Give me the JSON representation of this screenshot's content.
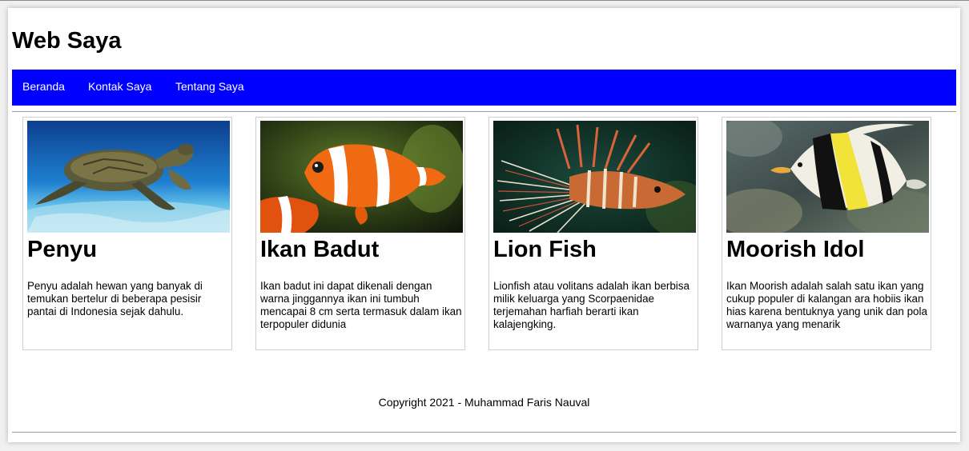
{
  "site": {
    "title": "Web Saya"
  },
  "nav": {
    "items": [
      {
        "label": "Beranda"
      },
      {
        "label": "Kontak Saya"
      },
      {
        "label": "Tentang Saya"
      }
    ],
    "background_color": "#0000ff",
    "text_color": "#ffffff"
  },
  "cards": [
    {
      "title": "Penyu",
      "text": "Penyu adalah hewan yang banyak di temukan bertelur di beberapa pesisir pantai di Indonesia sejak dahulu."
    },
    {
      "title": "Ikan Badut",
      "text": "Ikan badut ini dapat dikenali dengan warna jinggannya ikan ini tumbuh mencapai 8 cm serta termasuk dalam ikan terpopuler didunia"
    },
    {
      "title": "Lion Fish",
      "text": "Lionfish atau volitans adalah ikan berbisa milik keluarga yang Scorpaenidae terjemahan harfiah berarti ikan kalajengking."
    },
    {
      "title": "Moorish Idol",
      "text": "Ikan Moorish adalah salah satu ikan yang cukup populer di kalangan ara hobiis ikan hias karena bentuknya yang unik dan pola warnanya yang menarik"
    }
  ],
  "footer": {
    "copyright": "Copyright 2021 - Muhammad Faris Nauval"
  }
}
